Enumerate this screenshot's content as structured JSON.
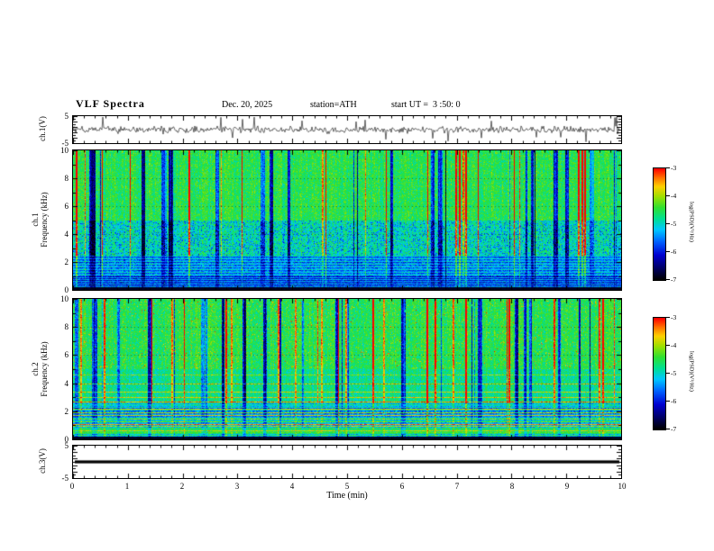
{
  "header": {
    "title": "VLF Spectra",
    "date": "Dec. 20, 2025",
    "station": "station=ATH",
    "start_ut": "start UT =  3 :50: 0"
  },
  "xaxis": {
    "label": "Time (min)",
    "lim": [
      0,
      10
    ],
    "ticks": [
      0,
      1,
      2,
      3,
      4,
      5,
      6,
      7,
      8,
      9,
      10
    ]
  },
  "colormap": {
    "stops": [
      [
        0,
        "#000000"
      ],
      [
        0.1,
        "#000060"
      ],
      [
        0.22,
        "#0000d0"
      ],
      [
        0.34,
        "#0060ff"
      ],
      [
        0.45,
        "#00c8ff"
      ],
      [
        0.55,
        "#00e090"
      ],
      [
        0.65,
        "#30e030"
      ],
      [
        0.75,
        "#a0e000"
      ],
      [
        0.84,
        "#ffd000"
      ],
      [
        0.92,
        "#ff7000"
      ],
      [
        1,
        "#ff0000"
      ]
    ]
  },
  "chart_data": [
    {
      "id": "ch1_waveform",
      "type": "line",
      "ylabel": "ch.1(V)",
      "ylim": [
        -5,
        5
      ],
      "yticks": [
        5,
        -5
      ],
      "xlim": [
        0,
        10
      ],
      "xlabel": "Time (min)",
      "summary": "Broadband noisy voltage trace centered on 0 V with frequent impulsive spikes reaching roughly +/-5 V over the full 10 minute record."
    },
    {
      "id": "ch1_spectrogram",
      "type": "heatmap",
      "ylabel_channel": "ch.1",
      "ylabel_axis": "Frequency (kHz)",
      "ylim": [
        0,
        10
      ],
      "yticks": [
        0,
        2,
        4,
        6,
        8,
        10
      ],
      "xlim": [
        0,
        10
      ],
      "xlabel": "Time (min)",
      "zlim": [
        -7,
        -3
      ],
      "colorbar_label": "log(PSD)(V²/Hz)",
      "colorbar_ticks": [
        -3,
        -4,
        -5,
        -6,
        -7
      ],
      "summary": "0-10 kHz spectrogram: green background near log(PSD) = -5, dense vertical impulsive streaks (hot red streaks near -3 and dark blue dropouts near -6.5), a diffuse bluer cloud between about 2.5 and 5 kHz, a horizontally banded blue striped region below about 2.5 kHz, and a solid black band at the lowest frequencies (about 0-0.25 kHz)."
    },
    {
      "id": "ch2_spectrogram",
      "type": "heatmap",
      "ylabel_channel": "ch.2",
      "ylabel_axis": "Frequency (kHz)",
      "ylim": [
        0,
        10
      ],
      "yticks": [
        0,
        2,
        4,
        6,
        8,
        10
      ],
      "xlim": [
        0,
        10
      ],
      "xlabel": "Time (min)",
      "zlim": [
        -7,
        -3
      ],
      "colorbar_label": "log(PSD)(V²/Hz)",
      "colorbar_ticks": [
        -3,
        -4,
        -5,
        -6,
        -7
      ],
      "line_frequencies_khz": [
        4.6,
        4.0,
        3.4,
        3.0,
        2.7,
        2.45,
        2.2,
        1.95,
        1.7,
        1.5,
        1.3,
        1.1,
        0.95,
        0.8,
        0.65,
        0.5
      ],
      "summary": "0-10 kHz spectrogram: green background with vertical impulsive streaks (red and dark blue) above about 5 kHz, many persistent horizontal emission/interference lines between about 0.5 and 5 kHz, fine yellow-green banding below 2 kHz, and a solid black band at the lowest frequencies."
    },
    {
      "id": "ch3_waveform",
      "type": "line",
      "ylabel": "ch.3(V)",
      "ylim": [
        -5,
        5
      ],
      "yticks": [
        5,
        -5
      ],
      "xlim": [
        0,
        10
      ],
      "xlabel": "Time (min)",
      "summary": "Flat thick trace at 0 V for the whole record (channel inactive)."
    }
  ]
}
